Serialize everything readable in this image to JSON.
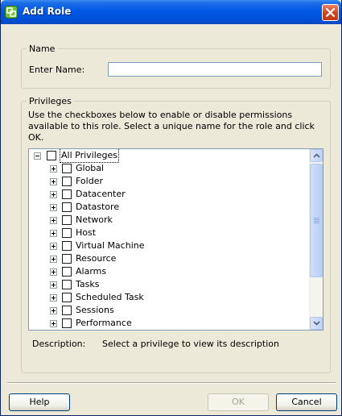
{
  "window": {
    "title": "Add Role",
    "close_icon": "close-icon"
  },
  "name_section": {
    "legend": "Name",
    "label": "Enter Name:",
    "value": "",
    "placeholder": ""
  },
  "privileges_section": {
    "legend": "Privileges",
    "instructions": "Use the checkboxes below to enable or disable permissions available to this role. Select a unique name for the role and click OK.",
    "root": {
      "label": "All Privileges",
      "expanded": true,
      "checked": false
    },
    "items": [
      {
        "label": "Global",
        "checked": false
      },
      {
        "label": "Folder",
        "checked": false
      },
      {
        "label": "Datacenter",
        "checked": false
      },
      {
        "label": "Datastore",
        "checked": false
      },
      {
        "label": "Network",
        "checked": false
      },
      {
        "label": "Host",
        "checked": false
      },
      {
        "label": "Virtual Machine",
        "checked": false
      },
      {
        "label": "Resource",
        "checked": false
      },
      {
        "label": "Alarms",
        "checked": false
      },
      {
        "label": "Tasks",
        "checked": false
      },
      {
        "label": "Scheduled Task",
        "checked": false
      },
      {
        "label": "Sessions",
        "checked": false
      },
      {
        "label": "Performance",
        "checked": false
      }
    ],
    "description_label": "Description:",
    "description_value": "Select a privilege to view its description"
  },
  "buttons": {
    "help": "Help",
    "ok": "OK",
    "ok_enabled": false,
    "cancel": "Cancel"
  },
  "colors": {
    "titlebar": "#0058e6",
    "dialog_bg": "#ece9d8",
    "close_button": "#d1421a",
    "field_border": "#7f9db9"
  }
}
